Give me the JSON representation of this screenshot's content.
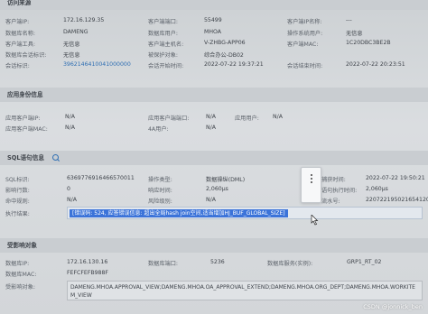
{
  "top_section": {
    "title": "访问来源",
    "client_ip": {
      "label": "客户端IP:",
      "value": "172.16.129.35"
    },
    "client_port": {
      "label": "客户端端口:",
      "value": "55499"
    },
    "client_ip_name": {
      "label": "客户端IP名称:",
      "value": "---"
    },
    "db_name": {
      "label": "数据库名称:",
      "value": "DAMENG"
    },
    "db_user": {
      "label": "数据库用户:",
      "value": "MHOA"
    },
    "os_user": {
      "label": "操作系统用户:",
      "value": "无信息"
    },
    "client_tool": {
      "label": "客户端工具:",
      "value": "无信息"
    },
    "client_host": {
      "label": "客户端主机名:",
      "value": "V-ZHBG-APP06"
    },
    "client_mac": {
      "label": "客户端MAC:",
      "value": "1C20DBC3BE2B"
    },
    "db_instance": {
      "label": "数据库会话标识:",
      "value": "无信息"
    },
    "protected_object": {
      "label": "被保护对象:",
      "value": "综合办公-DB02"
    },
    "empty_label": {
      "label": "",
      "value": ""
    },
    "session_id": {
      "label": "会话标识:",
      "value": "3962146410041000000"
    },
    "session_start": {
      "label": "会话开始时间:",
      "value": "2022-07-22 19:37:21"
    },
    "session_end": {
      "label": "会话结束时间:",
      "value": "2022-07-22 20:23:51"
    }
  },
  "app_section": {
    "title": "应用身份信息",
    "app_client_ip": {
      "label": "应用客户端IP:",
      "value": "N/A"
    },
    "app_client_port": {
      "label": "应用客户端端口:",
      "value": "N/A"
    },
    "app_user": {
      "label": "应用用户:",
      "value": "N/A"
    },
    "app_client_mac": {
      "label": "应用客户端MAC:",
      "value": "N/A"
    },
    "four_a_user": {
      "label": "4A用户:",
      "value": "N/A"
    }
  },
  "sql_section": {
    "title": "SQL语句信息",
    "sql_id": {
      "label": "SQL标识:",
      "value": "6369776916466570011"
    },
    "op_type": {
      "label": "操作类型:",
      "value": "数据操纵(DML)"
    },
    "capture_time": {
      "label": "捕获时间:",
      "value": "2022-07-22 19:50:21"
    },
    "affected_rows": {
      "label": "影响行数:",
      "value": "0"
    },
    "response_time": {
      "label": "响应时间:",
      "value": "2,060μs"
    },
    "sql_exec_time": {
      "label": "语句执行时间:",
      "value": "2,060μs"
    },
    "rows_returned": {
      "label": "命中规则:",
      "value": "N/A"
    },
    "risk_level": {
      "label": "风险级别:",
      "value": "N/A"
    },
    "flow_id": {
      "label": "流水号:",
      "value": "2207221950216541207"
    },
    "exec_result": {
      "label": "执行结果:",
      "value": "[错误码: 524, 应答错误信息: 超出全局hash join空间,适当增加HJ_BUF_GLOBAL_SIZE]"
    }
  },
  "target_section": {
    "title": "受影响对象",
    "db_ip": {
      "label": "数据库IP:",
      "value": "172.16.130.16"
    },
    "db_port": {
      "label": "数据库端口:",
      "value": "5236"
    },
    "db_service": {
      "label": "数据库服务(实例):",
      "value": "GRP1_RT_02"
    },
    "db_mac": {
      "label": "数据库MAC:",
      "value": "FEFCFEFB988F"
    },
    "affected_objects": {
      "label": "受影响对象:",
      "value": "DAMENG.MHOA.APPROVAL_VIEW;DAMENG.MHOA.OA_APPROVAL_EXTEND;DAMENG.MHOA.ORG_DEPT;DAMENG.MHOA.WORKITEM_VIEW"
    }
  },
  "watermark": "CSDN @jonnick_ben",
  "colors": {
    "link": "#2f6fb3",
    "highlight": "#3b73d9"
  }
}
